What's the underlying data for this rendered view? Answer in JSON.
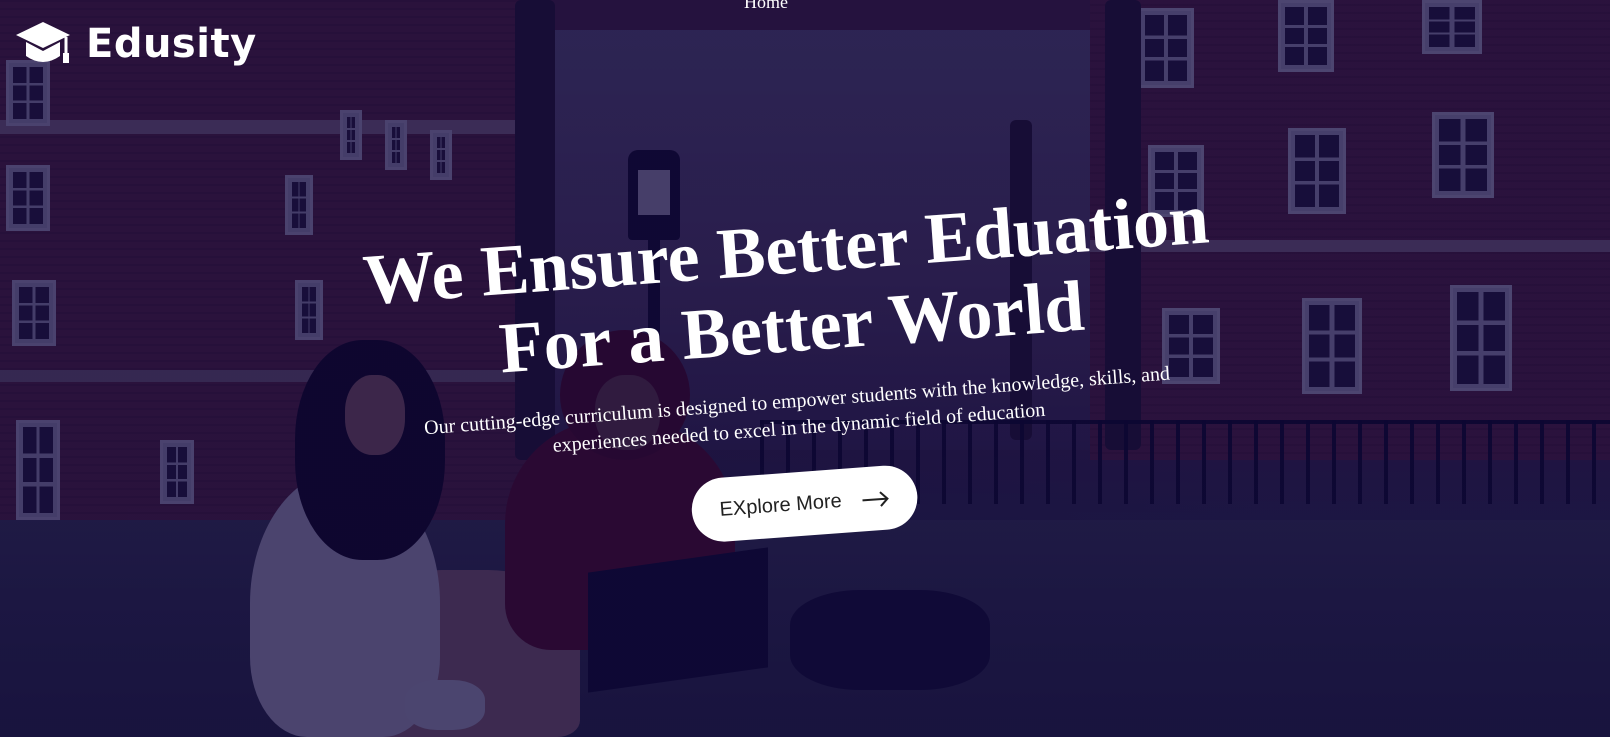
{
  "nav": {
    "brand": "Edusity",
    "brand_icon": "graduation-cap-icon",
    "links": [
      {
        "label": "Home"
      }
    ]
  },
  "hero": {
    "title_line1": "We Ensure Better Eduation",
    "title_line2": "For a Better World",
    "description": "Our cutting-edge curriculum is designed to empower students with the knowledge, skills, and experiences needed to excel in the dynamic field of education",
    "cta_label": "EXplore More",
    "cta_icon": "arrow-right-icon"
  },
  "colors": {
    "overlay": "#08003a",
    "text": "#ffffff",
    "button_bg": "#ffffff",
    "button_text": "#212121"
  }
}
